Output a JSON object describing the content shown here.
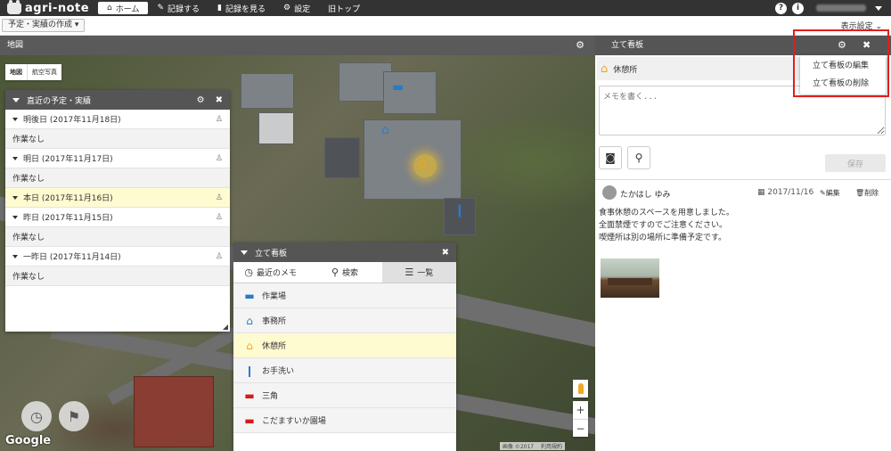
{
  "app": {
    "brand": "agri-note"
  },
  "nav": {
    "items": [
      {
        "icon": "⌂",
        "label": "ホーム"
      },
      {
        "icon": "✎",
        "label": "記録する"
      },
      {
        "icon": "▮",
        "label": "記録を見る"
      },
      {
        "icon": "⚙",
        "label": "設定"
      },
      {
        "icon": "",
        "label": "旧トップ"
      }
    ],
    "help": "?",
    "info": "i"
  },
  "subbar": {
    "create_label": "予定・実績の作成 ▾",
    "display_settings": "表示設定"
  },
  "map": {
    "title": "地図",
    "map_type": [
      "地図",
      "航空写真"
    ],
    "zoom_in": "+",
    "zoom_out": "−",
    "google": "Google",
    "attribution": "画像 ©2017 　利用規約"
  },
  "schedule": {
    "title": "直近の予定・実績",
    "rows": [
      {
        "label": "明後日 (2017年11月18日)",
        "content": "作業なし"
      },
      {
        "label": "明日 (2017年11月17日)",
        "content": "作業なし"
      },
      {
        "label": "本日 (2017年11月16日)",
        "content": ""
      },
      {
        "label": "昨日 (2017年11月15日)",
        "content": "作業なし"
      },
      {
        "label": "一昨日 (2017年11月14日)",
        "content": "作業なし"
      }
    ]
  },
  "boards_panel": {
    "title": "立て看板",
    "tabs": [
      "最近のメモ",
      "検索",
      "一覧"
    ],
    "items": [
      {
        "label": "作業場",
        "color": "#2a7ac9"
      },
      {
        "label": "事務所",
        "color": "#2a7ac9"
      },
      {
        "label": "休憩所",
        "color": "#f2a51a"
      },
      {
        "label": "お手洗い",
        "color": "#2a7ac9"
      },
      {
        "label": "三角",
        "color": "#d7191c"
      },
      {
        "label": "こだますいか園場",
        "color": "#d7191c"
      }
    ]
  },
  "detail": {
    "title": "立て看板",
    "board_name": "休憩所",
    "memo_placeholder": "メモを書く...",
    "save_label": "保存",
    "post": {
      "author": "たかはし ゆみ",
      "date": "2017/11/16",
      "edit": "編集",
      "delete": "削除",
      "lines": [
        "食事休憩のスペースを用意しました。",
        "全面禁煙ですのでご注意ください。",
        "喫煙所は別の場所に準備予定です。"
      ]
    }
  },
  "dropdown": {
    "items": [
      "立て看板の編集",
      "立て看板の削除"
    ]
  },
  "colors": {
    "highlight": "#e21d1d",
    "today_bg": "#fffbd1"
  }
}
